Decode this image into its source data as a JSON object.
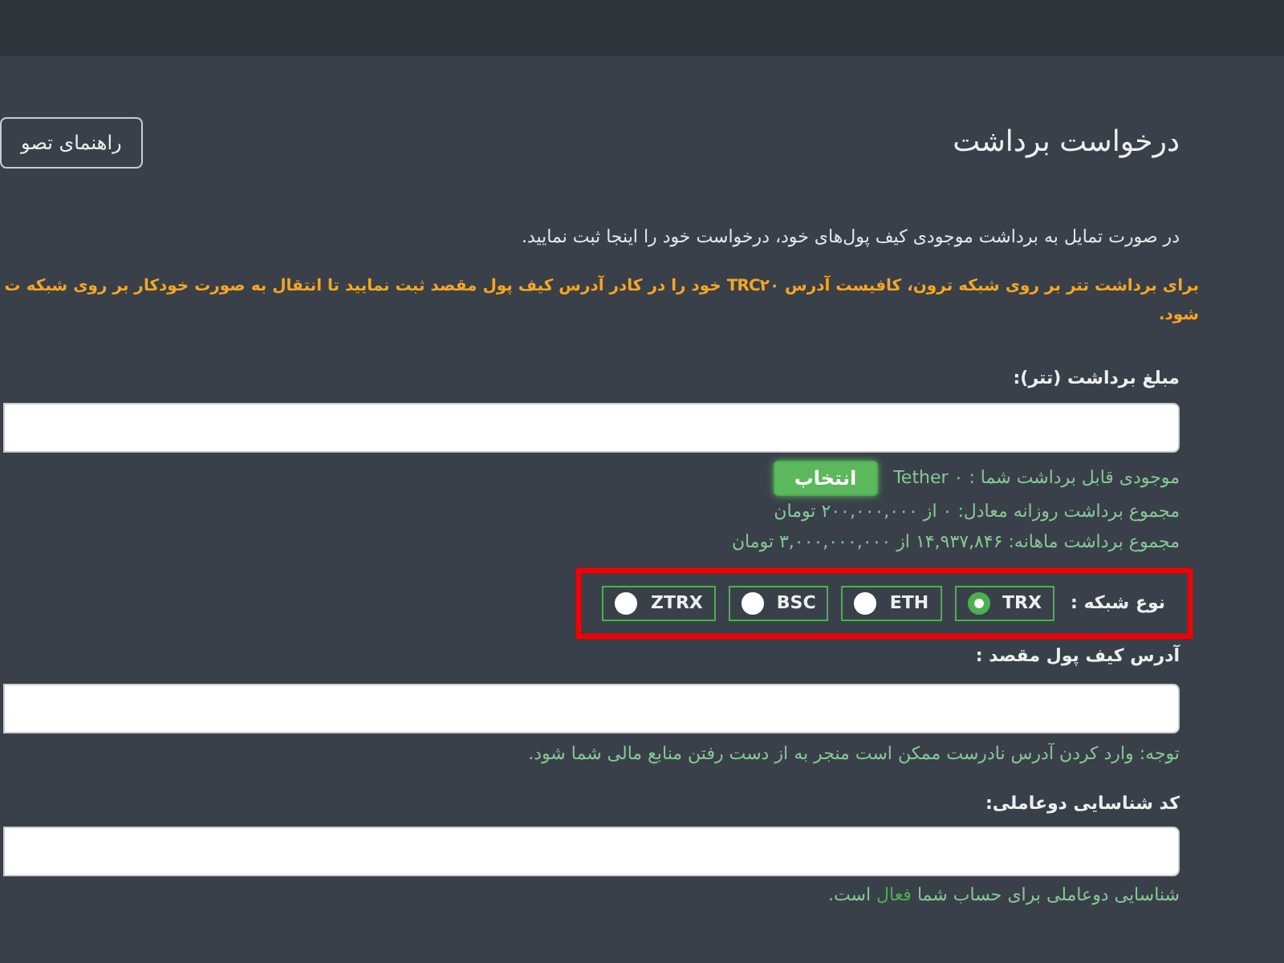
{
  "page": {
    "title": "درخواست برداشت",
    "guide_button": "راهنمای تصو"
  },
  "intro": "در صورت تمایل به برداشت موجودی کیف پول‌های خود، درخواست خود را اینجا ثبت نمایید.",
  "warning_lines": [
    "برای برداشت تتر بر روی شبکه ترون، کافیست آدرس TRC۲۰ خود را در کادر آدرس کیف پول مقصد ثبت نمایید تا انتقال به صورت خودکار بر روی شبکه ت",
    "شود."
  ],
  "amount": {
    "label": "مبلغ برداشت (تتر):"
  },
  "balance": {
    "text": "موجودی قابل برداشت شما : ۰ Tether",
    "button": "انتخاب"
  },
  "limits": [
    "مجموع برداشت روزانه معادل: ۰ از ۲۰۰,۰۰۰,۰۰۰ تومان",
    "مجموع برداشت ماهانه: ۱۴,۹۳۷,۸۴۶ از ۳,۰۰۰,۰۰۰,۰۰۰ تومان"
  ],
  "network": {
    "label": "نوع شبکه :",
    "highlighted": true,
    "options": [
      {
        "label": "TRX",
        "selected": true
      },
      {
        "label": "ETH",
        "selected": false
      },
      {
        "label": "BSC",
        "selected": false
      },
      {
        "label": "ZTRX",
        "selected": false
      }
    ]
  },
  "address": {
    "label": "آدرس کیف پول مقصد :",
    "note": "توجه: وارد کردن آدرس نادرست ممکن است منجر به از دست رفتن منابع مالی شما شود."
  },
  "two_factor": {
    "label": "کد شناسایی دوعاملی:",
    "note_before": "شناسایی دوعاملی برای حساب شما",
    "status": "فعال",
    "note_after": "است."
  }
}
